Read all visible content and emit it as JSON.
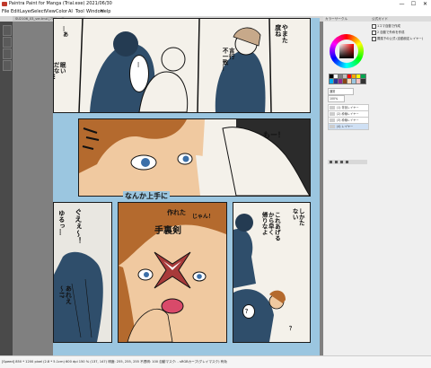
{
  "window": {
    "title": "Paintra Paint for Manga (Trial.exe) 2021/06/30",
    "minimize": "—",
    "maximize": "☐",
    "close": "✕"
  },
  "menu": [
    "File",
    "Edit",
    "Layer",
    "Select",
    "View",
    "Color",
    "AI",
    "Tool",
    "Window",
    "Help"
  ],
  "document_tab": "SU2106_03_ver.tmd [75% ×4]",
  "manga": {
    "top_left_vertical": "…あ",
    "top_center_vertical": "…",
    "top_right_bubble_1": "やまた\n度ね",
    "top_right_bubble_2": "言行\n不一致…",
    "top_right_bubble_3": "眠い\nだな…",
    "middle_right_text": "もー！",
    "banner_text": "なんか上手に",
    "lower_left_text_1": "ゆるっ…",
    "lower_left_text_2": "ぐえぇ～！",
    "lower_left_text_3": "あれえ\n～!?",
    "lower_center_sfx_1": "じゃん！",
    "lower_center_sfx_2": "手裏剣",
    "lower_center_sfx_3": "作れた",
    "lower_right_bubble_1": "しかた\nない",
    "lower_right_bubble_2": "これあげる\nから早く\n帰りなよ",
    "lower_right_bubble_3": "？",
    "lower_right_bubble_4": "？"
  },
  "right_panel": {
    "header_left": "カラーサークル",
    "header_right": "公式ガイド",
    "options": [
      "1コマ自動で作成",
      "2 自動で外枠を作成",
      "置換下の公式 (自動設定レイヤー)"
    ],
    "blend_label": "通常",
    "opacity_label": "100%",
    "layers": [
      "(1) 背景レイヤー",
      "(2) 枠線レイヤー",
      "(3) 枠線レイヤー",
      "(4) レイヤー"
    ]
  },
  "palette": [
    "#000000",
    "#ffffff",
    "#808080",
    "#c0c0c0",
    "#ff0000",
    "#f7a600",
    "#ffff00",
    "#00a651",
    "#00aeef",
    "#2e3192",
    "#92278f",
    "#8b4513",
    "#ffd9b3",
    "#9bc6e0",
    "#f4c2c2",
    "#333333"
  ],
  "status": "[Speed]  850 * 1200 pixel  (2.8 * 5.1cm)  600 dpi  150 %  (137, 147)  明度: 255, 255, 255  不透明: 100  自動マスク: -  sRGBカーブ(グレイマスク) 有効"
}
